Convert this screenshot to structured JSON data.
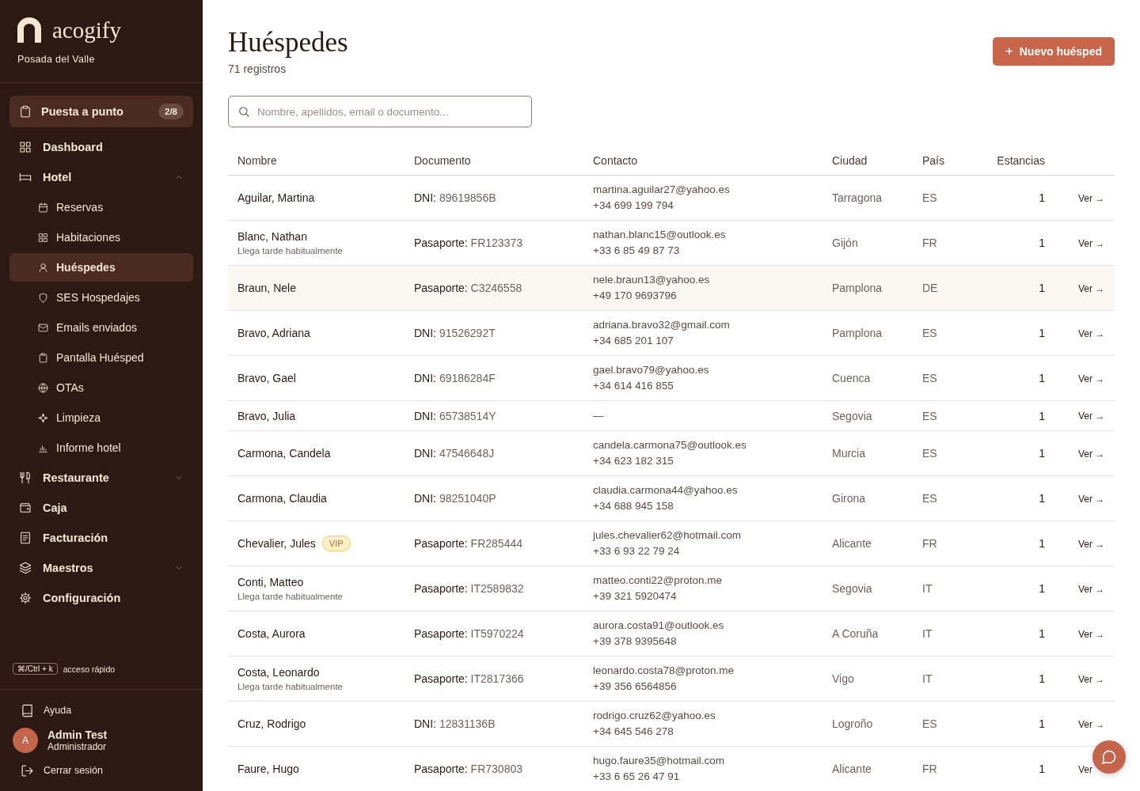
{
  "brand": {
    "name": "acogify",
    "property": "Posada del Valle"
  },
  "setup": {
    "label": "Puesta a punto",
    "badge": "2/8"
  },
  "nav": [
    {
      "label": "Dashboard",
      "selected": false
    },
    {
      "label": "Hotel",
      "selected": false,
      "expanded": true,
      "children": [
        {
          "label": "Reservas",
          "selected": false
        },
        {
          "label": "Habitaciones",
          "selected": false
        },
        {
          "label": "Huéspedes",
          "selected": true
        },
        {
          "label": "SES Hospedajes",
          "selected": false
        },
        {
          "label": "Emails enviados",
          "selected": false
        },
        {
          "label": "Pantalla Huésped",
          "selected": false
        },
        {
          "label": "OTAs",
          "selected": false
        },
        {
          "label": "Limpieza",
          "selected": false
        },
        {
          "label": "Informe hotel",
          "selected": false
        }
      ]
    },
    {
      "label": "Restaurante",
      "selected": false,
      "expanded": false
    },
    {
      "label": "Caja",
      "selected": false
    },
    {
      "label": "Facturación",
      "selected": false
    },
    {
      "label": "Maestros",
      "selected": false,
      "expanded": false
    },
    {
      "label": "Configuración",
      "selected": false
    }
  ],
  "shortcut": {
    "keys": "⌘/Ctrl + k",
    "label": "acceso rápido"
  },
  "help": "Ayuda",
  "user": {
    "initial": "A",
    "name": "Admin Test",
    "role": "Administrador"
  },
  "logout": "Cerrar sesión",
  "page": {
    "title": "Huéspedes",
    "subtitle": "71 registros",
    "new_button": "Nuevo huésped",
    "new_button_icon": "+"
  },
  "search": {
    "placeholder": "Nombre, apellidos, email o documento..."
  },
  "table": {
    "columns": [
      "Nombre",
      "Documento",
      "Contacto",
      "Ciudad",
      "País",
      "Estancias"
    ],
    "rows": [
      {
        "name": "Aguilar, Martina",
        "doc_label": "DNI:",
        "doc_number": "89619856B",
        "contact": [
          "martina.aguilar27@yahoo.es",
          "+34 699 199 794"
        ],
        "city": "Tarragona",
        "country": "ES",
        "stays": "1",
        "link": "Ver →",
        "highlighted": false
      },
      {
        "name": "Blanc, Nathan",
        "note": "Llega tarde habitualmente",
        "doc_label": "Pasaporte:",
        "doc_number": "FR123373",
        "contact": [
          "nathan.blanc15@outlook.es",
          "+33 6 85 49 87 73"
        ],
        "city": "Gijón",
        "country": "FR",
        "stays": "1",
        "link": "Ver →",
        "highlighted": false
      },
      {
        "name": "Braun, Nele",
        "doc_label": "Pasaporte:",
        "doc_number": "C3246558",
        "contact": [
          "nele.braun13@yahoo.es",
          "+49 170 9693796"
        ],
        "city": "Pamplona",
        "country": "DE",
        "stays": "1",
        "link": "Ver →",
        "highlighted": true
      },
      {
        "name": "Bravo, Adriana",
        "doc_label": "DNI:",
        "doc_number": "91526292T",
        "contact": [
          "adriana.bravo32@gmail.com",
          "+34 685 201 107"
        ],
        "city": "Pamplona",
        "country": "ES",
        "stays": "1",
        "link": "Ver →",
        "highlighted": false
      },
      {
        "name": "Bravo, Gael",
        "doc_label": "DNI:",
        "doc_number": "69186284F",
        "contact": [
          "gael.bravo79@yahoo.es",
          "+34 614 416 855"
        ],
        "city": "Cuenca",
        "country": "ES",
        "stays": "1",
        "link": "Ver →",
        "highlighted": false
      },
      {
        "name": "Bravo, Julia",
        "doc_label": "DNI:",
        "doc_number": "65738514Y",
        "contact": [
          "—"
        ],
        "city": "Segovia",
        "country": "ES",
        "stays": "1",
        "link": "Ver →",
        "highlighted": false
      },
      {
        "name": "Carmona, Candela",
        "doc_label": "DNI:",
        "doc_number": "47546648J",
        "contact": [
          "candela.carmona75@outlook.es",
          "+34 623 182 315"
        ],
        "city": "Murcia",
        "country": "ES",
        "stays": "1",
        "link": "Ver →",
        "highlighted": false
      },
      {
        "name": "Carmona, Claudia",
        "doc_label": "DNI:",
        "doc_number": "98251040P",
        "contact": [
          "claudia.carmona44@yahoo.es",
          "+34 688 945 158"
        ],
        "city": "Girona",
        "country": "ES",
        "stays": "1",
        "link": "Ver →",
        "highlighted": false
      },
      {
        "name": "Chevalier, Jules",
        "badge": "VIP",
        "doc_label": "Pasaporte:",
        "doc_number": "FR285444",
        "contact": [
          "jules.chevalier62@hotmail.com",
          "+33 6 93 22 79 24"
        ],
        "city": "Alicante",
        "country": "FR",
        "stays": "1",
        "link": "Ver →",
        "highlighted": false
      },
      {
        "name": "Conti, Matteo",
        "note": "Llega tarde habitualmente",
        "doc_label": "Pasaporte:",
        "doc_number": "IT2589832",
        "contact": [
          "matteo.conti22@proton.me",
          "+39 321 5920474"
        ],
        "city": "Segovia",
        "country": "IT",
        "stays": "1",
        "link": "Ver →",
        "highlighted": false
      },
      {
        "name": "Costa, Aurora",
        "doc_label": "Pasaporte:",
        "doc_number": "IT5970224",
        "contact": [
          "aurora.costa91@outlook.es",
          "+39 378 9395648"
        ],
        "city": "A Coruña",
        "country": "IT",
        "stays": "1",
        "link": "Ver →",
        "highlighted": false
      },
      {
        "name": "Costa, Leonardo",
        "note": "Llega tarde habitualmente",
        "doc_label": "Pasaporte:",
        "doc_number": "IT2817366",
        "contact": [
          "leonardo.costa78@proton.me",
          "+39 356 6564856"
        ],
        "city": "Vigo",
        "country": "IT",
        "stays": "1",
        "link": "Ver →",
        "highlighted": false
      },
      {
        "name": "Cruz, Rodrigo",
        "doc_label": "DNI:",
        "doc_number": "12831136B",
        "contact": [
          "rodrigo.cruz62@yahoo.es",
          "+34 645 546 278"
        ],
        "city": "Logroño",
        "country": "ES",
        "stays": "1",
        "link": "Ver →",
        "highlighted": false
      },
      {
        "name": "Faure, Hugo",
        "doc_label": "Pasaporte:",
        "doc_number": "FR730803",
        "contact": [
          "hugo.faure35@hotmail.com",
          "+33 6 65 26 47 91"
        ],
        "city": "Alicante",
        "country": "FR",
        "stays": "1",
        "link": "Ver",
        "highlighted": false
      }
    ]
  }
}
